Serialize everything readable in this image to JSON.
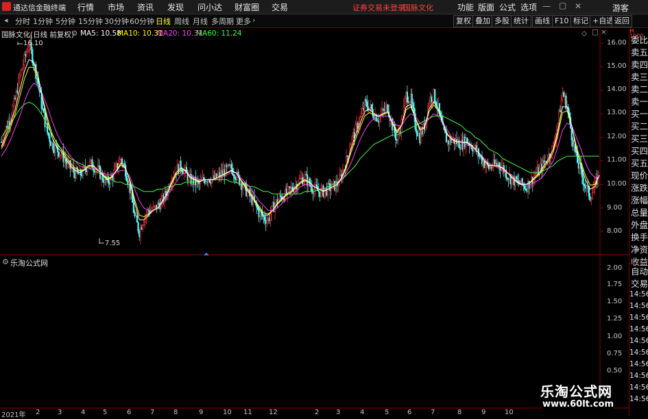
{
  "menubar": {
    "app_title": "通达信金融终端",
    "menus": [
      "行情",
      "市场",
      "资讯",
      "发现",
      "问小达",
      "财富圈",
      "交易"
    ],
    "notice": "证券交易未登录",
    "stock_name": "国脉文化",
    "right_menus": [
      "功能",
      "版面",
      "公式",
      "选项"
    ],
    "guest": "游客"
  },
  "periodbar": {
    "periods": [
      "分时",
      "1分钟",
      "5分钟",
      "15分钟",
      "30分钟",
      "60分钟",
      "日线",
      "周线",
      "月线",
      "多周期",
      "更多"
    ],
    "active": "日线",
    "tools": [
      "复权",
      "叠加",
      "多股",
      "统计",
      "画线",
      "F10",
      "标记",
      "+自选",
      "返回"
    ]
  },
  "indicators": {
    "title": "国脉文化(日线 前复权)",
    "ma5": "MA5: 10.58",
    "ma10": "MA10: 10.31",
    "ma20": "MA20: 10.31",
    "ma60": "MA60: 11.24",
    "colors": {
      "ma5": "#ffffff",
      "ma10": "#ffff00",
      "ma20": "#ff40ff",
      "ma60": "#40ff40"
    }
  },
  "chart_data": {
    "type": "candlestick",
    "high_label": "16.10",
    "low_label": "7.55",
    "y_ticks": [
      "16.00",
      "15.00",
      "14.00",
      "13.00",
      "12.00",
      "11.00",
      "10.00",
      "9.00",
      "8.00"
    ],
    "x_ticks": [
      "2021年",
      "2",
      "3",
      "4",
      "5",
      "6",
      "7",
      "8",
      "9",
      "10",
      "11",
      "12",
      "2",
      "3",
      "4",
      "5",
      "6",
      "7",
      "8",
      "9",
      "10"
    ],
    "close_path": [
      11.8,
      12.4,
      12.9,
      13.6,
      14.6,
      15.3,
      16.0,
      15.2,
      14.3,
      13.1,
      12.2,
      11.7,
      11.5,
      11.3,
      11.0,
      10.7,
      10.5,
      10.4,
      10.6,
      10.9,
      10.8,
      10.6,
      10.3,
      10.1,
      10.3,
      10.7,
      11.1,
      10.6,
      9.8,
      8.6,
      8.0,
      8.6,
      8.9,
      8.9,
      9.1,
      9.3,
      9.7,
      10.3,
      10.6,
      10.8,
      10.5,
      10.2,
      10.1,
      10.0,
      10.2,
      10.3,
      10.2,
      10.3,
      10.5,
      10.6,
      10.7,
      10.4,
      10.1,
      9.8,
      9.5,
      9.2,
      8.8,
      8.6,
      8.5,
      9.0,
      9.3,
      9.5,
      9.6,
      9.8,
      10.0,
      10.2,
      10.3,
      10.0,
      9.8,
      9.7,
      9.7,
      9.8,
      9.9,
      10.0,
      10.4,
      11.0,
      11.8,
      12.3,
      12.8,
      13.4,
      13.3,
      13.0,
      12.8,
      13.1,
      13.3,
      12.5,
      11.9,
      12.6,
      13.8,
      13.6,
      12.5,
      12.0,
      12.5,
      13.6,
      13.8,
      13.2,
      12.3,
      11.8,
      11.9,
      11.8,
      11.7,
      11.9,
      11.7,
      11.5,
      11.2,
      10.9,
      10.7,
      10.8,
      10.9,
      10.7,
      10.4,
      10.2,
      10.1,
      10.0,
      9.9,
      10.1,
      10.4,
      10.6,
      10.9,
      11.2,
      11.6,
      12.6,
      13.9,
      13.3,
      12.1,
      11.1,
      10.5,
      9.9,
      9.5,
      9.9,
      10.5
    ],
    "ma5_path": [
      11.6,
      12.1,
      12.6,
      13.2,
      14.0,
      14.8,
      15.3,
      15.2,
      14.6,
      13.6,
      12.7,
      12.0,
      11.6,
      11.4,
      11.1,
      10.8,
      10.6,
      10.5,
      10.6,
      10.8,
      10.8,
      10.6,
      10.4,
      10.2,
      10.3,
      10.6,
      10.9,
      10.7,
      10.1,
      9.2,
      8.5,
      8.5,
      8.7,
      8.9,
      9.0,
      9.3,
      9.6,
      10.1,
      10.5,
      10.7,
      10.6,
      10.3,
      10.2,
      10.1,
      10.2,
      10.2,
      10.2,
      10.3,
      10.4,
      10.5,
      10.6,
      10.5,
      10.2,
      9.9,
      9.6,
      9.3,
      9.0,
      8.7,
      8.7,
      8.9,
      9.2,
      9.4,
      9.6,
      9.7,
      9.9,
      10.1,
      10.2,
      10.1,
      9.9,
      9.8,
      9.7,
      9.8,
      9.9,
      10.0,
      10.3,
      10.8,
      11.5,
      12.1,
      12.6,
      13.1,
      13.2,
      13.0,
      12.9,
      13.0,
      13.1,
      12.6,
      12.2,
      12.5,
      13.3,
      13.4,
      12.8,
      12.3,
      12.4,
      13.2,
      13.5,
      13.2,
      12.6,
      12.1,
      11.9,
      11.8,
      11.8,
      11.8,
      11.7,
      11.5,
      11.3,
      11.0,
      10.8,
      10.8,
      10.8,
      10.7,
      10.5,
      10.3,
      10.1,
      10.0,
      10.0,
      10.1,
      10.3,
      10.5,
      10.8,
      11.1,
      11.5,
      12.3,
      13.3,
      13.3,
      12.5,
      11.5,
      10.8,
      10.2,
      9.8,
      9.9,
      10.4
    ],
    "ma20_path": [
      11.2,
      11.5,
      11.9,
      12.4,
      12.9,
      13.5,
      14.0,
      14.3,
      14.2,
      13.8,
      13.3,
      12.7,
      12.2,
      11.8,
      11.5,
      11.2,
      11.0,
      10.8,
      10.7,
      10.7,
      10.7,
      10.6,
      10.5,
      10.4,
      10.4,
      10.5,
      10.6,
      10.6,
      10.3,
      9.8,
      9.3,
      9.0,
      8.9,
      8.9,
      9.0,
      9.2,
      9.5,
      9.8,
      10.1,
      10.4,
      10.5,
      10.4,
      10.3,
      10.2,
      10.2,
      10.2,
      10.2,
      10.3,
      10.3,
      10.4,
      10.5,
      10.5,
      10.3,
      10.1,
      9.9,
      9.6,
      9.3,
      9.1,
      8.9,
      8.9,
      9.0,
      9.2,
      9.4,
      9.5,
      9.7,
      9.9,
      10.0,
      10.0,
      9.9,
      9.8,
      9.8,
      9.8,
      9.9,
      10.0,
      10.2,
      10.5,
      10.9,
      11.4,
      11.9,
      12.3,
      12.6,
      12.8,
      12.9,
      12.9,
      12.9,
      12.7,
      12.5,
      12.5,
      12.8,
      13.0,
      12.9,
      12.6,
      12.5,
      12.8,
      13.0,
      12.9,
      12.6,
      12.3,
      12.0,
      11.9,
      11.8,
      11.7,
      11.6,
      11.5,
      11.3,
      11.1,
      10.9,
      10.8,
      10.7,
      10.6,
      10.5,
      10.4,
      10.2,
      10.1,
      10.0,
      10.0,
      10.1,
      10.2,
      10.4,
      10.7,
      11.0,
      11.6,
      12.3,
      12.6,
      12.5,
      12.0,
      11.5,
      10.9,
      10.5,
      10.3,
      10.3
    ],
    "ma60_path": [
      12.0,
      12.3,
      12.6,
      12.9,
      13.2,
      13.4,
      13.5,
      13.4,
      13.2,
      12.9,
      12.5,
      12.1,
      11.8,
      11.5,
      11.3,
      11.1,
      11.0,
      10.9,
      10.8,
      10.7,
      10.6,
      10.5,
      10.4,
      10.3,
      10.2,
      10.1,
      10.1,
      10.0,
      10.0,
      9.9,
      9.8,
      9.7,
      9.7,
      9.7,
      9.8,
      9.8,
      9.9,
      9.9,
      10.0,
      10.0,
      10.1,
      10.1,
      10.1,
      10.1,
      10.2,
      10.2,
      10.2,
      10.2,
      10.2,
      10.2,
      10.1,
      10.1,
      10.0,
      10.0,
      9.9,
      9.9,
      9.8,
      9.7,
      9.7,
      9.6,
      9.6,
      9.6,
      9.6,
      9.6,
      9.6,
      9.6,
      9.7,
      9.7,
      9.7,
      9.8,
      9.8,
      9.9,
      10.0,
      10.1,
      10.2,
      10.4,
      10.6,
      10.8,
      11.1,
      11.3,
      11.5,
      11.7,
      11.8,
      11.9,
      12.0,
      12.1,
      12.1,
      12.2,
      12.3,
      12.4,
      12.5,
      12.6,
      12.7,
      12.8,
      12.9,
      12.9,
      12.9,
      12.8,
      12.7,
      12.6,
      12.5,
      12.3,
      12.2,
      12.0,
      11.9,
      11.7,
      11.5,
      11.4,
      11.3,
      11.1,
      11.0,
      10.9,
      10.8,
      10.7,
      10.6,
      10.5,
      10.5,
      10.5,
      10.6,
      10.7,
      10.8,
      11.0,
      11.1,
      11.2,
      11.2,
      11.2,
      11.2,
      11.2,
      11.2,
      11.2,
      11.2
    ]
  },
  "subpanel": {
    "title": "乐淘公式网",
    "y_ticks": [
      "2.00",
      "1.75",
      "1.50",
      "1.25",
      "1.00",
      "0.75",
      "0.50"
    ]
  },
  "rightpanel": {
    "items": [
      "委比",
      "卖五",
      "卖四",
      "卖三",
      "卖二",
      "卖一",
      "买一",
      "买二",
      "买三",
      "买四",
      "买五",
      "现价",
      "涨跌",
      "涨幅",
      "总量",
      "外盘",
      "换手",
      "净资",
      "收益",
      "自动",
      "交易"
    ],
    "times": [
      "14:56",
      "14:56",
      "14:56",
      "14:56",
      "14:56",
      "14:56",
      "14:56",
      "14:56",
      "14:56",
      "14:56"
    ],
    "top_labels": [
      "R",
      "1000"
    ]
  },
  "watermark": {
    "name": "乐淘公式网",
    "url": "www.60lt.com"
  }
}
